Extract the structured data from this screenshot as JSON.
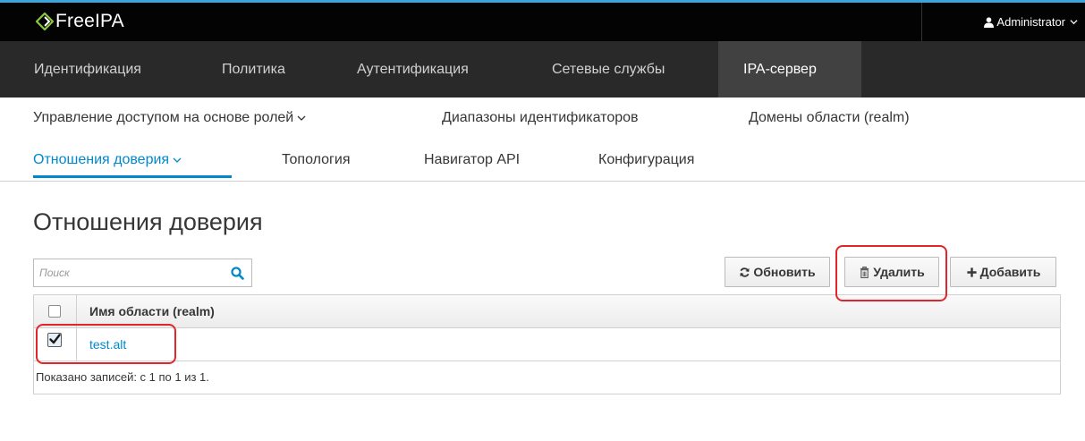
{
  "header": {
    "brand": "FreeIPA",
    "user": "Administrator",
    "colors": {
      "accent": "#39a5dc",
      "topbar": "#030303",
      "nav": "#292929",
      "link": "#0088ce",
      "annotation": "#e0262b"
    }
  },
  "primary_nav": [
    {
      "label": "Идентификация",
      "active": false
    },
    {
      "label": "Политика",
      "active": false
    },
    {
      "label": "Аутентификация",
      "active": false
    },
    {
      "label": "Сетевые службы",
      "active": false
    },
    {
      "label": "IPA-сервер",
      "active": true
    }
  ],
  "secondary_nav": {
    "row1": [
      {
        "label": "Управление доступом на основе ролей",
        "has_dropdown": true
      },
      {
        "label": "Диапазоны идентификаторов",
        "has_dropdown": false
      },
      {
        "label": "Домены области (realm)",
        "has_dropdown": false
      }
    ],
    "row2": [
      {
        "label": "Отношения доверия",
        "has_dropdown": true,
        "active": true
      },
      {
        "label": "Топология",
        "has_dropdown": false
      },
      {
        "label": "Навигатор API",
        "has_dropdown": false
      },
      {
        "label": "Конфигурация",
        "has_dropdown": false
      }
    ]
  },
  "page": {
    "title": "Отношения доверия",
    "search": {
      "placeholder": "Поиск",
      "value": ""
    },
    "buttons": {
      "refresh": "Обновить",
      "delete": "Удалить",
      "add": "Добавить"
    }
  },
  "table": {
    "columns": [
      "Имя области (realm)"
    ],
    "rows": [
      {
        "name": "test.alt",
        "checked": true
      }
    ],
    "footer": "Показано записей: с 1 по 1 из 1."
  },
  "icons": [
    "freeipa-logo-icon",
    "user-icon",
    "chevron-down-icon",
    "search-icon",
    "refresh-icon",
    "trash-icon",
    "plus-icon",
    "checkbox-icon"
  ]
}
